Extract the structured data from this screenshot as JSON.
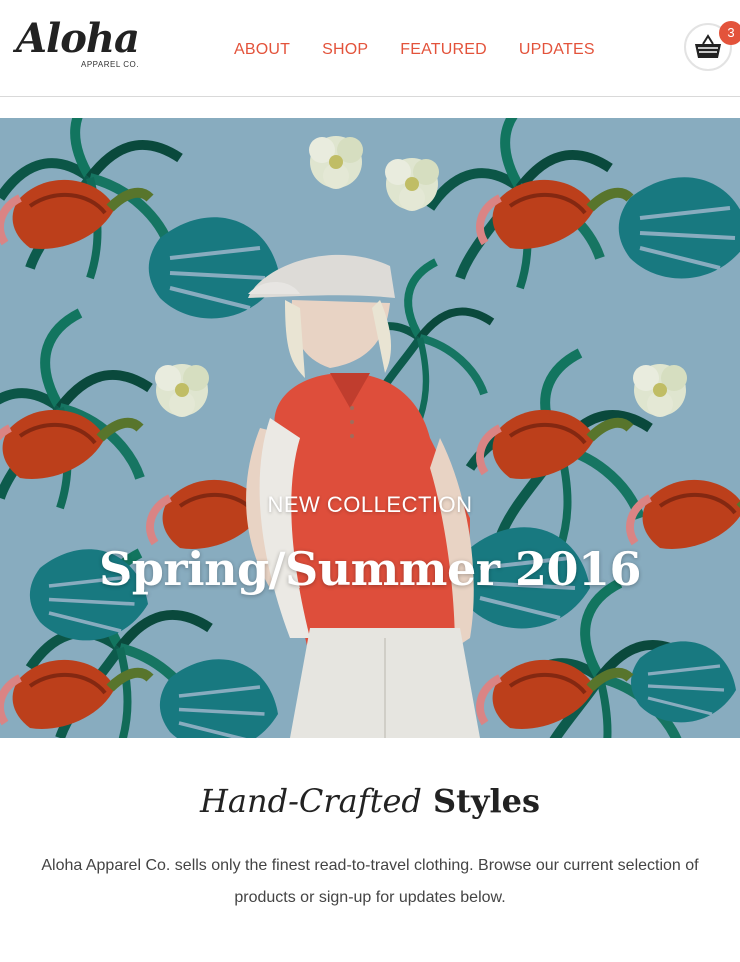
{
  "brand": {
    "name": "Aloha",
    "sub": "APPAREL CO."
  },
  "nav": {
    "items": [
      {
        "label": "ABOUT"
      },
      {
        "label": "SHOP"
      },
      {
        "label": "FEATURED"
      },
      {
        "label": "UPDATES"
      }
    ]
  },
  "cart": {
    "count": "3",
    "icon": "basket-icon"
  },
  "hero": {
    "eyebrow": "NEW COLLECTION",
    "title": "Spring/Summer 2016"
  },
  "intro": {
    "heading_italic": "Hand-Crafted",
    "heading_bold": "Styles",
    "text": "Aloha Apparel Co. sells only the finest read-to-travel clothing. Browse our current selection of products or sign-up for updates below."
  },
  "colors": {
    "accent": "#e3533b",
    "hero_bg": "#8eb3c7",
    "shirt": "#e8523e"
  }
}
